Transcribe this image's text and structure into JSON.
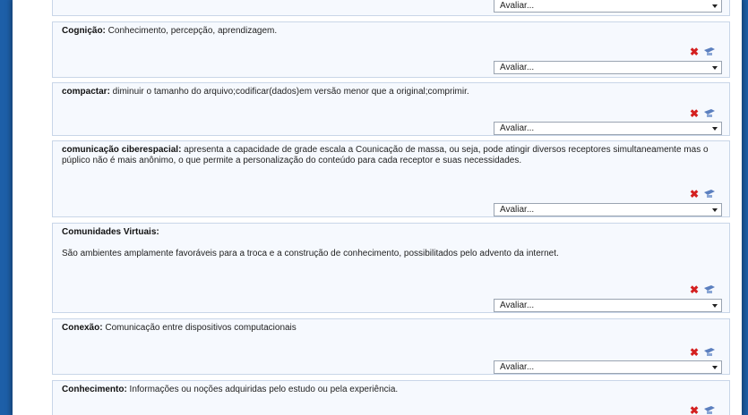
{
  "entries": [
    {
      "term": "",
      "definition": "",
      "select": "Avaliar..."
    },
    {
      "term": "Cognição:",
      "definition": " Conhecimento, percepção, aprendizagem.",
      "select": "Avaliar..."
    },
    {
      "term": "compactar:",
      "definition": " diminuir o tamanho do arquivo;codificar(dados)em versão menor que a original;comprimir.",
      "select": "Avaliar..."
    },
    {
      "term": "comunicação ciberespacial:",
      "definition": " apresenta a capacidade de grade escala a Counicação de massa, ou seja, pode atingir diversos receptores simultaneamente mas o púplico não é mais anônimo, o que permite a personalização do conteúdo para cada receptor e suas necessidades.",
      "select": "Avaliar..."
    },
    {
      "term": "Comunidades Virtuais:",
      "definition": "São ambientes amplamente favoráveis para a troca e a construção de conhecimento, possibilitados pelo advento da internet.",
      "select": "Avaliar..."
    },
    {
      "term": "Conexão:",
      "definition": " Comunicação entre dispositivos computacionais",
      "select": "Avaliar..."
    },
    {
      "term": "Conhecimento:",
      "definition": " Informações ou noções adquiridas pelo estudo ou pela experiência.",
      "select": ""
    }
  ],
  "icons": {
    "delete": "delete-icon",
    "edit": "edit-icon",
    "chevron": "chevron-down-icon"
  },
  "colors": {
    "background": "#1d5fa8",
    "delete": "#d42020",
    "entry_bg": "#f6f9fe"
  }
}
